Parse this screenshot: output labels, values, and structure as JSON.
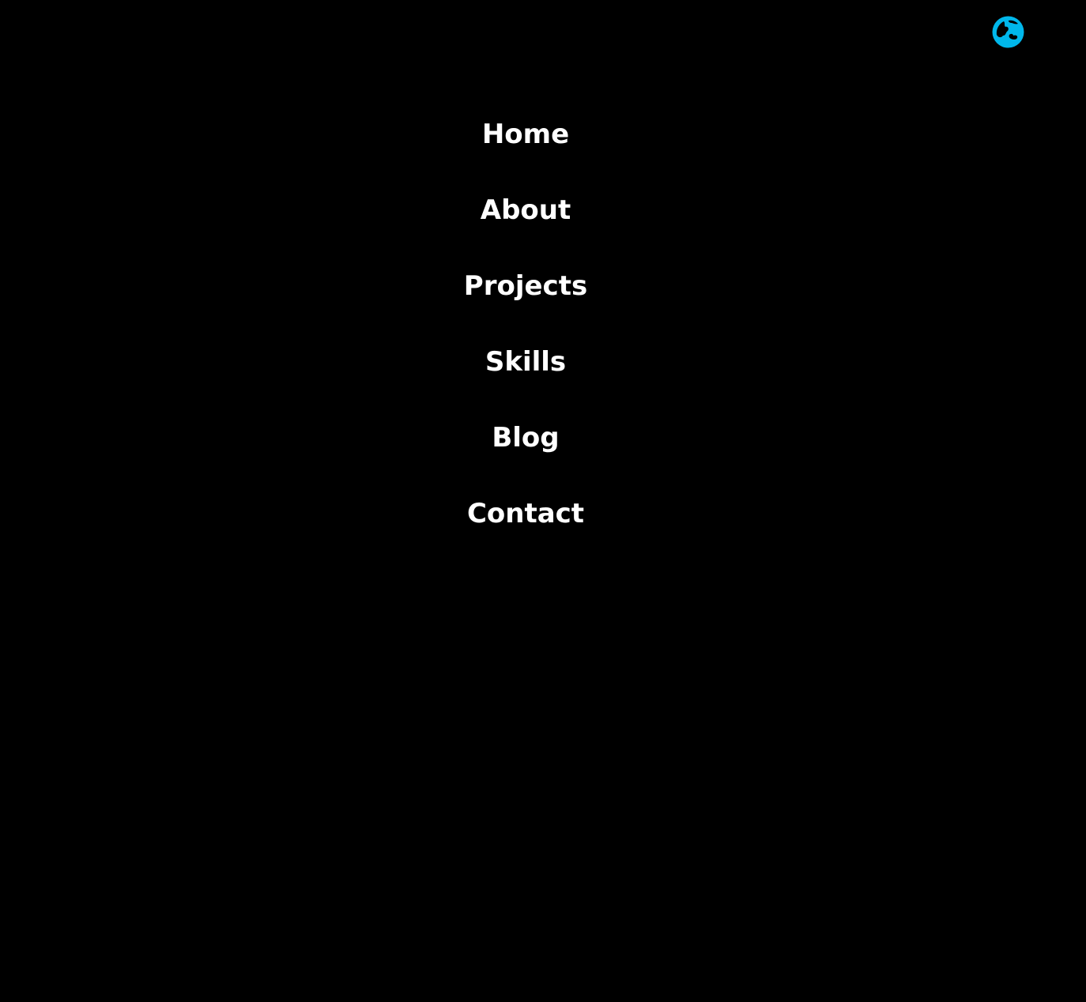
{
  "header": {
    "language_icon": "globe-icon",
    "accent_color": "#00b7eb"
  },
  "nav": {
    "items": [
      {
        "label": "Home"
      },
      {
        "label": "About"
      },
      {
        "label": "Projects"
      },
      {
        "label": "Skills"
      },
      {
        "label": "Blog"
      },
      {
        "label": "Contact"
      }
    ]
  },
  "colors": {
    "background": "#000000",
    "text": "#ffffff"
  }
}
